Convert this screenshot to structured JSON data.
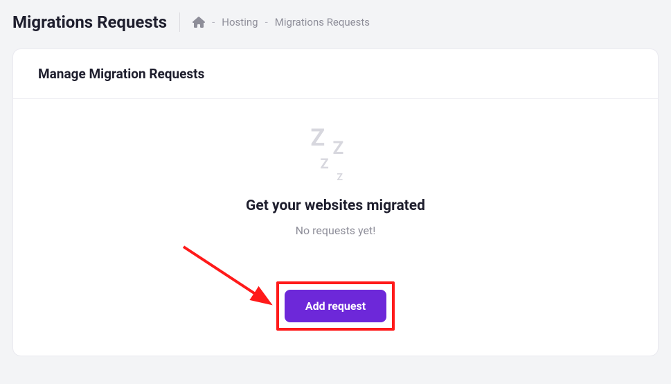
{
  "page_title": "Migrations Requests",
  "breadcrumb": {
    "home_aria": "Home",
    "items": [
      "Hosting",
      "Migrations Requests"
    ]
  },
  "card": {
    "header_title": "Manage Migration Requests",
    "empty_state": {
      "title": "Get your websites migrated",
      "subtitle": "No requests yet!",
      "button_label": "Add request"
    }
  },
  "annotation": {
    "highlight_color": "#ff1a1a"
  }
}
